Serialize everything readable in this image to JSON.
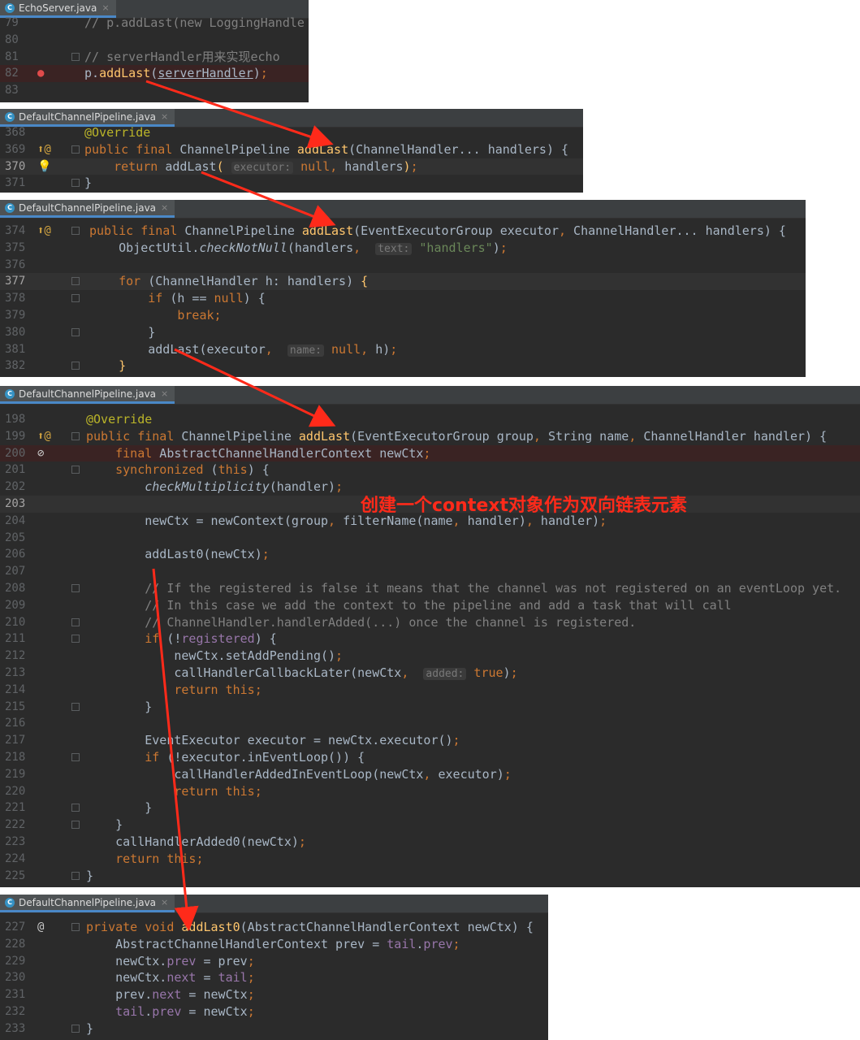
{
  "panels": [
    {
      "tab": "EchoServer.java",
      "lines": [
        {
          "n": "79",
          "html": "<span class=\"cm\">// p.addLast(new LoggingHandle</span>"
        },
        {
          "n": "80",
          "html": ""
        },
        {
          "n": "81",
          "html": "<span class=\"cm\">// serverHandler用来实现echo</span>"
        },
        {
          "n": "82",
          "html": "p.<span class=\"fn\">addLast</span>(<span class=\"ul\">serverHandler</span>)<span class=\"kw\">;</span>"
        },
        {
          "n": "83",
          "html": ""
        }
      ]
    },
    {
      "tab": "DefaultChannelPipeline.java",
      "lines": [
        {
          "n": "368",
          "html": "<span class=\"ann\">@Override</span>"
        },
        {
          "n": "369",
          "html": "<span class=\"kw\">public final</span> ChannelPipeline <span class=\"fn\">addLast</span>(ChannelHandler... handlers) {"
        },
        {
          "n": "370",
          "html": "    <span class=\"kw\">return</span> addLast<span class=\"fn\">(</span> <span class=\"hint\">executor:</span> <span class=\"kw\">null,</span> handlers<span class=\"fn\">)</span><span class=\"kw\">;</span>"
        },
        {
          "n": "371",
          "html": "}"
        }
      ]
    },
    {
      "tab": "DefaultChannelPipeline.java",
      "lines": [
        {
          "n": "374",
          "html": "<span class=\"kw\">public final</span> ChannelPipeline <span class=\"fn\">addLast</span>(EventExecutorGroup executor<span class=\"kw\">,</span> ChannelHandler... handlers) {"
        },
        {
          "n": "375",
          "html": "    ObjectUtil.<span class=\"ital\">checkNotNull</span>(handlers<span class=\"kw\">,</span>  <span class=\"hint\">text:</span> <span class=\"str\">\"handlers\"</span>)<span class=\"kw\">;</span>"
        },
        {
          "n": "376",
          "html": ""
        },
        {
          "n": "377",
          "html": "    <span class=\"kw\">for</span> (ChannelHandler h: handlers) <span class=\"fn\">{</span>"
        },
        {
          "n": "378",
          "html": "        <span class=\"kw\">if</span> (h == <span class=\"kw\">null</span>) {"
        },
        {
          "n": "379",
          "html": "            <span class=\"kw\">break;</span>"
        },
        {
          "n": "380",
          "html": "        }"
        },
        {
          "n": "381",
          "html": "        addLast(executor<span class=\"kw\">,</span>  <span class=\"hint\">name:</span> <span class=\"kw\">null,</span> h)<span class=\"kw\">;</span>"
        },
        {
          "n": "382",
          "html": "    <span class=\"fn\">}</span>"
        }
      ]
    },
    {
      "tab": "DefaultChannelPipeline.java",
      "lines": [
        {
          "n": "198",
          "html": "<span class=\"ann\">@Override</span>"
        },
        {
          "n": "199",
          "html": "<span class=\"kw\">public final</span> ChannelPipeline <span class=\"fn\">addLast</span>(EventExecutorGroup group<span class=\"kw\">,</span> String name<span class=\"kw\">,</span> ChannelHandler handler) {"
        },
        {
          "n": "200",
          "html": "    <span class=\"kw\">final</span> AbstractChannelHandlerContext newCtx<span class=\"kw\">;</span>"
        },
        {
          "n": "201",
          "html": "    <span class=\"kw\">synchronized</span> (<span class=\"kw\">this</span>) {"
        },
        {
          "n": "202",
          "html": "        <span class=\"ital\">checkMultiplicity</span>(handler)<span class=\"kw\">;</span>"
        },
        {
          "n": "203",
          "html": ""
        },
        {
          "n": "204",
          "html": "        newCtx = newContext(group<span class=\"kw\">,</span> filterName(name<span class=\"kw\">,</span> handler)<span class=\"kw\">,</span> handler)<span class=\"kw\">;</span>"
        },
        {
          "n": "205",
          "html": ""
        },
        {
          "n": "206",
          "html": "        addLast0(newCtx)<span class=\"kw\">;</span>"
        },
        {
          "n": "207",
          "html": ""
        },
        {
          "n": "208",
          "html": "        <span class=\"cm\">// If the registered is false it means that the channel was not registered on an eventLoop yet.</span>"
        },
        {
          "n": "209",
          "html": "        <span class=\"cm\">// In this case we add the context to the pipeline and add a task that will call</span>"
        },
        {
          "n": "210",
          "html": "        <span class=\"cm\">// ChannelHandler.handlerAdded(...) once the channel is registered.</span>"
        },
        {
          "n": "211",
          "html": "        <span class=\"kw\">if</span> (!<span class=\"fld\">registered</span>) {"
        },
        {
          "n": "212",
          "html": "            newCtx.setAddPending()<span class=\"kw\">;</span>"
        },
        {
          "n": "213",
          "html": "            callHandlerCallbackLater(newCtx<span class=\"kw\">,</span>  <span class=\"hint\">added:</span> <span class=\"kw\">true</span>)<span class=\"kw\">;</span>"
        },
        {
          "n": "214",
          "html": "            <span class=\"kw\">return this;</span>"
        },
        {
          "n": "215",
          "html": "        }"
        },
        {
          "n": "216",
          "html": ""
        },
        {
          "n": "217",
          "html": "        EventExecutor executor = newCtx.executor()<span class=\"kw\">;</span>"
        },
        {
          "n": "218",
          "html": "        <span class=\"kw\">if</span> (!executor.inEventLoop()) {"
        },
        {
          "n": "219",
          "html": "            callHandlerAddedInEventLoop(newCtx<span class=\"kw\">,</span> executor)<span class=\"kw\">;</span>"
        },
        {
          "n": "220",
          "html": "            <span class=\"kw\">return this;</span>"
        },
        {
          "n": "221",
          "html": "        }"
        },
        {
          "n": "222",
          "html": "    }"
        },
        {
          "n": "223",
          "html": "    callHandlerAdded0(newCtx)<span class=\"kw\">;</span>"
        },
        {
          "n": "224",
          "html": "    <span class=\"kw\">return this;</span>"
        },
        {
          "n": "225",
          "html": "}"
        }
      ]
    },
    {
      "tab": "DefaultChannelPipeline.java",
      "lines": [
        {
          "n": "227",
          "html": "<span class=\"kw\">private void</span> <span class=\"fn\">addLast0</span>(AbstractChannelHandlerContext newCtx) {"
        },
        {
          "n": "228",
          "html": "    AbstractChannelHandlerContext prev = <span class=\"fld\">tail</span>.<span class=\"fld\">prev</span><span class=\"kw\">;</span>"
        },
        {
          "n": "229",
          "html": "    newCtx.<span class=\"fld\">prev</span> = prev<span class=\"kw\">;</span>"
        },
        {
          "n": "230",
          "html": "    newCtx.<span class=\"fld\">next</span> = <span class=\"fld\">tail</span><span class=\"kw\">;</span>"
        },
        {
          "n": "231",
          "html": "    prev.<span class=\"fld\">next</span> = newCtx<span class=\"kw\">;</span>"
        },
        {
          "n": "232",
          "html": "    <span class=\"fld\">tail</span>.<span class=\"fld\">prev</span> = newCtx<span class=\"kw\">;</span>"
        },
        {
          "n": "233",
          "html": "}"
        }
      ]
    }
  ],
  "annotation": "创建一个context对象作为双向链表元素",
  "colors": {
    "arrow": "#ff2a1a",
    "editor_bg": "#2b2b2b",
    "keyword": "#cc7832",
    "function": "#ffc66d"
  }
}
